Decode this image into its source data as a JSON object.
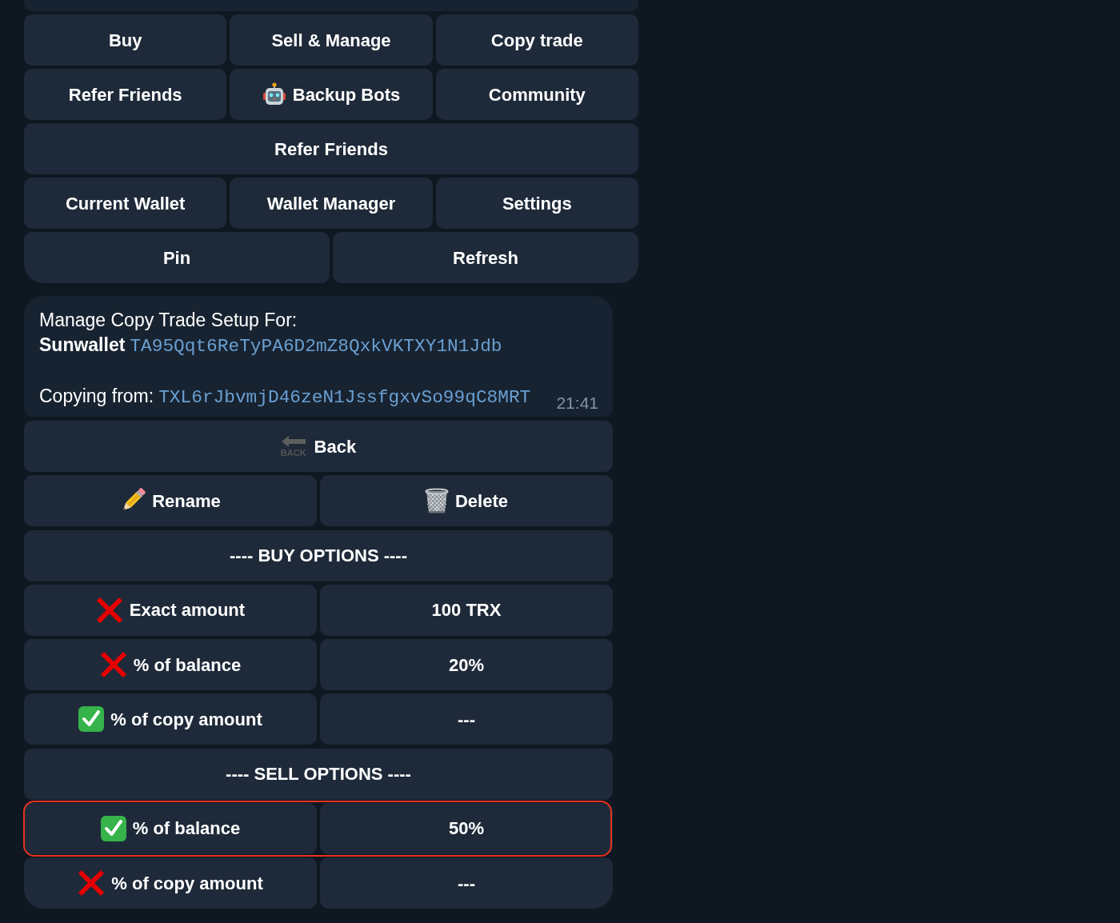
{
  "top_keyboard": {
    "rows": [
      {
        "buttons": [
          {
            "label": "Buy",
            "kind": "plain"
          },
          {
            "label": "Sell & Manage",
            "kind": "plain"
          },
          {
            "label": "Copy trade",
            "kind": "plain"
          }
        ]
      },
      {
        "buttons": [
          {
            "label": "Refer Friends",
            "kind": "plain"
          },
          {
            "label": "Backup Bots",
            "kind": "bots"
          },
          {
            "label": "Community",
            "kind": "plain"
          }
        ]
      },
      {
        "buttons": [
          {
            "label": "Refer Friends",
            "kind": "plain"
          }
        ]
      },
      {
        "buttons": [
          {
            "label": "Current Wallet",
            "kind": "plain"
          },
          {
            "label": "Wallet Manager",
            "kind": "plain"
          },
          {
            "label": "Settings",
            "kind": "plain"
          }
        ]
      },
      {
        "buttons": [
          {
            "label": "Pin",
            "kind": "plain"
          },
          {
            "label": "Refresh",
            "kind": "plain"
          }
        ]
      }
    ]
  },
  "message": {
    "heading": "Manage Copy Trade Setup For:",
    "wallet_name": "Sunwallet",
    "wallet_address": "TA95Qqt6ReTyPA6D2mZ8QxkVKTXY1N1Jdb",
    "copying_label": "Copying from:",
    "copying_address": "TXL6rJbvmjD46zeN1JssfgxvSo99qC8MRT",
    "time": "21:41"
  },
  "setup_keyboard": {
    "actions": [
      {
        "buttons": [
          {
            "label": "Back",
            "kind": "back",
            "sign_text": "BACK"
          }
        ]
      },
      {
        "buttons": [
          {
            "label": "Rename",
            "kind": "rename"
          },
          {
            "label": "Delete",
            "kind": "delete"
          }
        ]
      }
    ],
    "sections": [
      {
        "title": "---- BUY OPTIONS ----",
        "options": [
          {
            "label": "Exact amount",
            "checked": false,
            "value": "100 TRX",
            "highlighted": false
          },
          {
            "label": "% of balance",
            "checked": false,
            "value": "20%",
            "highlighted": false
          },
          {
            "label": "% of copy amount",
            "checked": true,
            "value": "---",
            "highlighted": false
          }
        ]
      },
      {
        "title": "---- SELL OPTIONS ----",
        "options": [
          {
            "label": "% of balance",
            "checked": true,
            "value": "50%",
            "highlighted": true
          },
          {
            "label": "% of copy amount",
            "checked": false,
            "value": "---",
            "highlighted": false
          }
        ]
      }
    ]
  }
}
